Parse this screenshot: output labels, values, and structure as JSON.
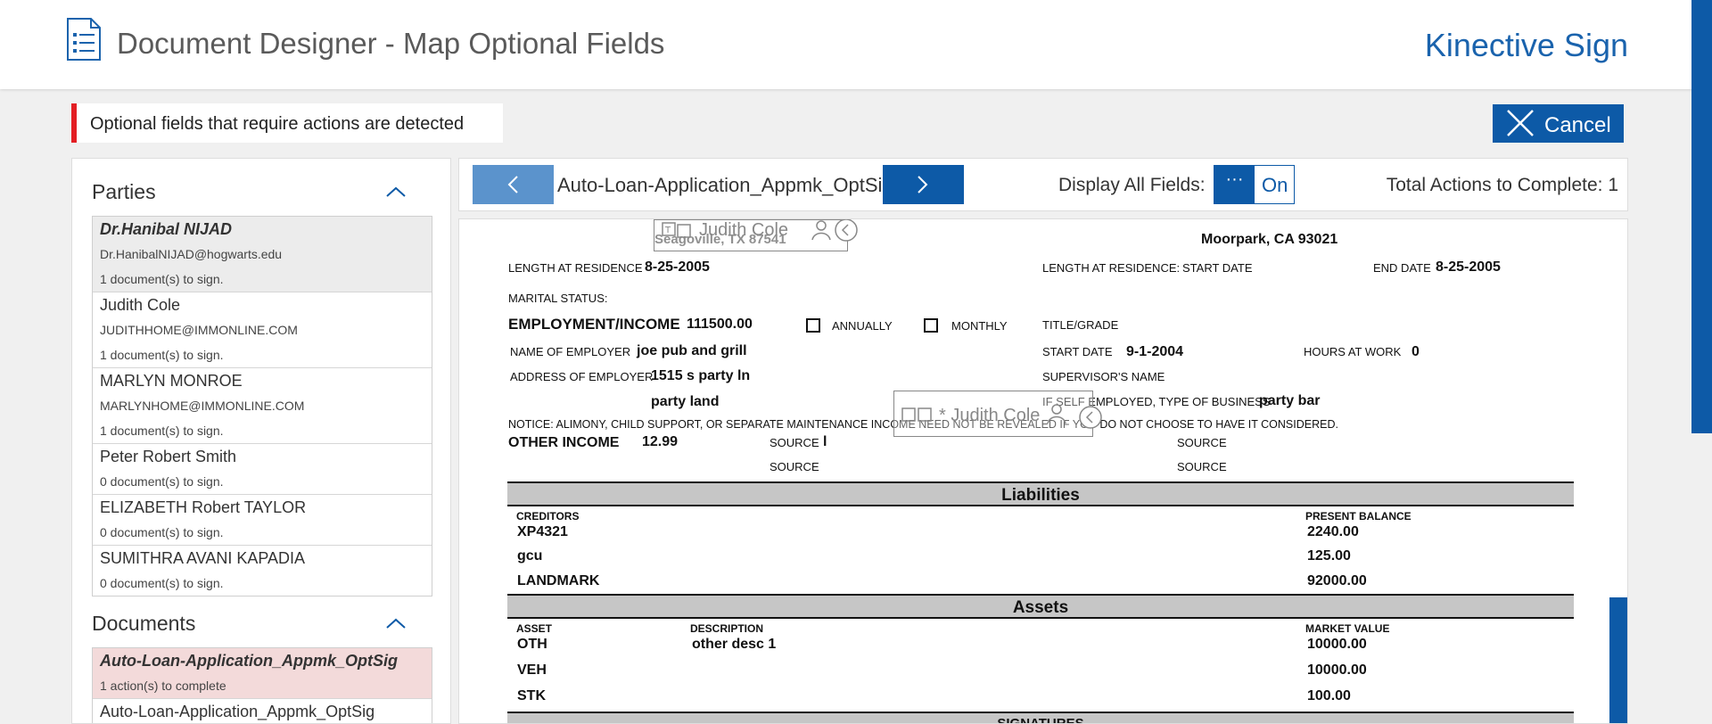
{
  "header": {
    "title": "Document Designer - Map Optional Fields",
    "brand": "Kinective Sign"
  },
  "alert": {
    "text": "Optional fields that require actions are detected"
  },
  "cancel": {
    "label": "Cancel"
  },
  "parties": {
    "heading": "Parties",
    "items": [
      {
        "name": "Dr.Hanibal NIJAD",
        "email": "Dr.HanibalNIJAD@hogwarts.edu",
        "docs": "1 document(s) to sign."
      },
      {
        "name": "Judith Cole",
        "email": "JUDITHHOME@IMMONLINE.COM",
        "docs": "1 document(s) to sign."
      },
      {
        "name": "MARLYN MONROE",
        "email": "MARLYNHOME@IMMONLINE.COM",
        "docs": "1 document(s) to sign."
      },
      {
        "name": "Peter Robert Smith",
        "docs": "0 document(s) to sign."
      },
      {
        "name": "ELIZABETH Robert TAYLOR",
        "docs": "0 document(s) to sign."
      },
      {
        "name": "SUMITHRA AVANI KAPADIA",
        "docs": "0 document(s) to sign."
      }
    ]
  },
  "documents": {
    "heading": "Documents",
    "items": [
      {
        "name": "Auto-Loan-Application_Appmk_OptSig",
        "status": "1 action(s) to complete"
      },
      {
        "name": "Auto-Loan-Application_Appmk_OptSig"
      }
    ]
  },
  "toolbar": {
    "doc_name": "Auto-Loan-Application_Appmk_OptSig",
    "display_label": "Display All Fields:",
    "toggle_knob": "···",
    "toggle_state": "On",
    "total_label": "Total Actions to Complete: 1"
  },
  "doc": {
    "prev_address_city": "Moorpark, CA 93021",
    "seagoville": "Seagoville, TX 87541",
    "field1_name": "Judith Cole",
    "field2_name": "* Judith Cole",
    "lar_label": "LENGTH AT RESIDENCE",
    "lar_value": "8-25-2005",
    "lar2_label": "LENGTH AT RESIDENCE:",
    "start_date_label": "START DATE",
    "end_date_label": "END DATE",
    "end_date_value": "8-25-2005",
    "marital_label": "MARITAL STATUS:",
    "emp_income_label": "EMPLOYMENT/INCOME",
    "emp_income_value": "111500.00",
    "annually": "ANNUALLY",
    "monthly": "MONTHLY",
    "title_grade": "TITLE/GRADE",
    "employer_name_label": "NAME OF EMPLOYER",
    "employer_name_value": "joe pub and grill",
    "start_date2_label": "START DATE",
    "start_date2_value": "9-1-2004",
    "hours_label": "HOURS AT WORK",
    "hours_value": "0",
    "employer_addr_label": "ADDRESS OF EMPLOYER",
    "employer_addr_line1": "1515 s party ln",
    "employer_addr_line2": "party land",
    "supervisor_label": "SUPERVISOR'S NAME",
    "self_emp_label": "IF SELF EMPLOYED, TYPE OF BUSINESS",
    "self_emp_value": "party bar",
    "notice": "NOTICE: ALIMONY, CHILD SUPPORT, OR SEPARATE MAINTENANCE INCOME NEED NOT BE REVEALED IF YOU DO NOT CHOOSE TO HAVE IT CONSIDERED.",
    "other_income_label": "OTHER INCOME",
    "other_income_value": "12.99",
    "source_label": "SOURCE",
    "source_value": "l",
    "liabilities_title": "Liabilities",
    "creditors_label": "CREDITORS",
    "present_balance_label": "PRESENT BALANCE",
    "liabilities": [
      {
        "creditor": "XP4321",
        "balance": "2240.00"
      },
      {
        "creditor": "gcu",
        "balance": "125.00"
      },
      {
        "creditor": "LANDMARK",
        "balance": "92000.00"
      }
    ],
    "assets_title": "Assets",
    "asset_label": "ASSET",
    "description_label": "DESCRIPTION",
    "market_value_label": "MARKET VALUE",
    "assets": [
      {
        "asset": "OTH",
        "description": "other desc 1",
        "value": "10000.00"
      },
      {
        "asset": "VEH",
        "description": "",
        "value": "10000.00"
      },
      {
        "asset": "STK",
        "description": "",
        "value": "100.00"
      }
    ],
    "signatures_title": "SIGNATURES"
  }
}
